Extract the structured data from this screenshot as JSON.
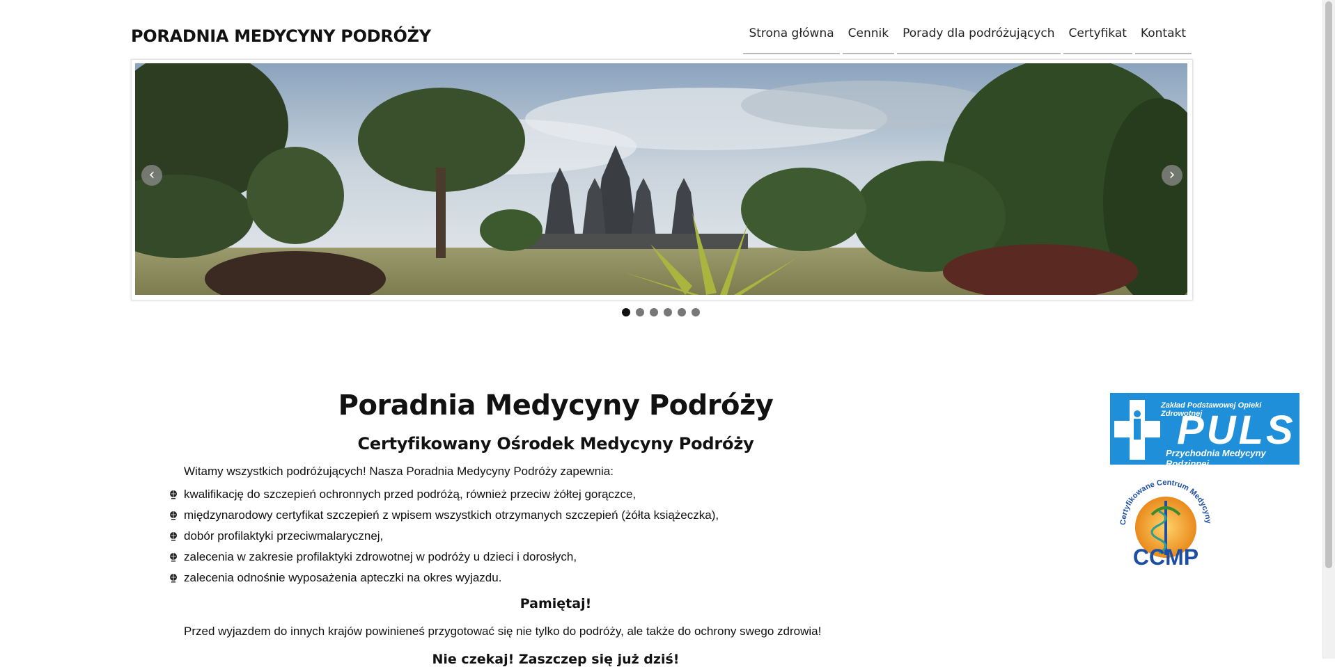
{
  "site": {
    "title": "PORADNIA MEDYCYNY PODRÓŻY"
  },
  "nav": {
    "items": [
      {
        "label": "Strona główna"
      },
      {
        "label": "Cennik"
      },
      {
        "label": "Porady dla podróżujących"
      },
      {
        "label": "Certyfikat"
      },
      {
        "label": "Kontakt"
      }
    ]
  },
  "slider": {
    "image": "panorama of temple ruins among trees",
    "prev_icon": "‹",
    "next_icon": "›",
    "slide_count": 6,
    "active_index": 0
  },
  "main": {
    "title": "Poradnia Medycyny Podróży",
    "subtitle": "Certyfikowany Ośrodek Medycyny Podróży",
    "intro": "Witamy wszystkich podróżujących! Nasza Poradnia Medycyny Podróży zapewnia:",
    "list": [
      "kwalifikację do szczepień ochronnych przed podróżą, również przeciw żółtej gorączce,",
      "międzynarodowy certyfikat szczepień z wpisem wszystkich otrzymanych szczepień (żółta książeczka),",
      "dobór profilaktyki przeciwmalarycznej,",
      "zalecenia w zakresie profilaktyki zdrowotnej w podróży u dzieci i dorosłych,",
      "zalecenia odnośnie wyposażenia apteczki na okres wyjazdu."
    ],
    "remember_heading": "Pamiętaj!",
    "remember_text": "Przed wyjazdem do innych krajów powinieneś przygotować się nie tylko do podróży, ale także do ochrony swego zdrowia!",
    "next_heading": "Nie czekaj! Zaszczep się już dziś!"
  },
  "sidebar": {
    "puls": {
      "line1": "Zakład Podstawowej Opieki Zdrowotnej",
      "word": "PULS",
      "line2": "Przychodnia Medycyny Rodzinnej"
    },
    "ccmp": {
      "ring_text": "Certyfikowane Centrum Medycyny Podróży",
      "acronym": "CCMP"
    }
  },
  "colors": {
    "puls_blue": "#1e8fd8",
    "ccmp_blue": "#1c4fa3",
    "accent_dark": "#111111"
  }
}
